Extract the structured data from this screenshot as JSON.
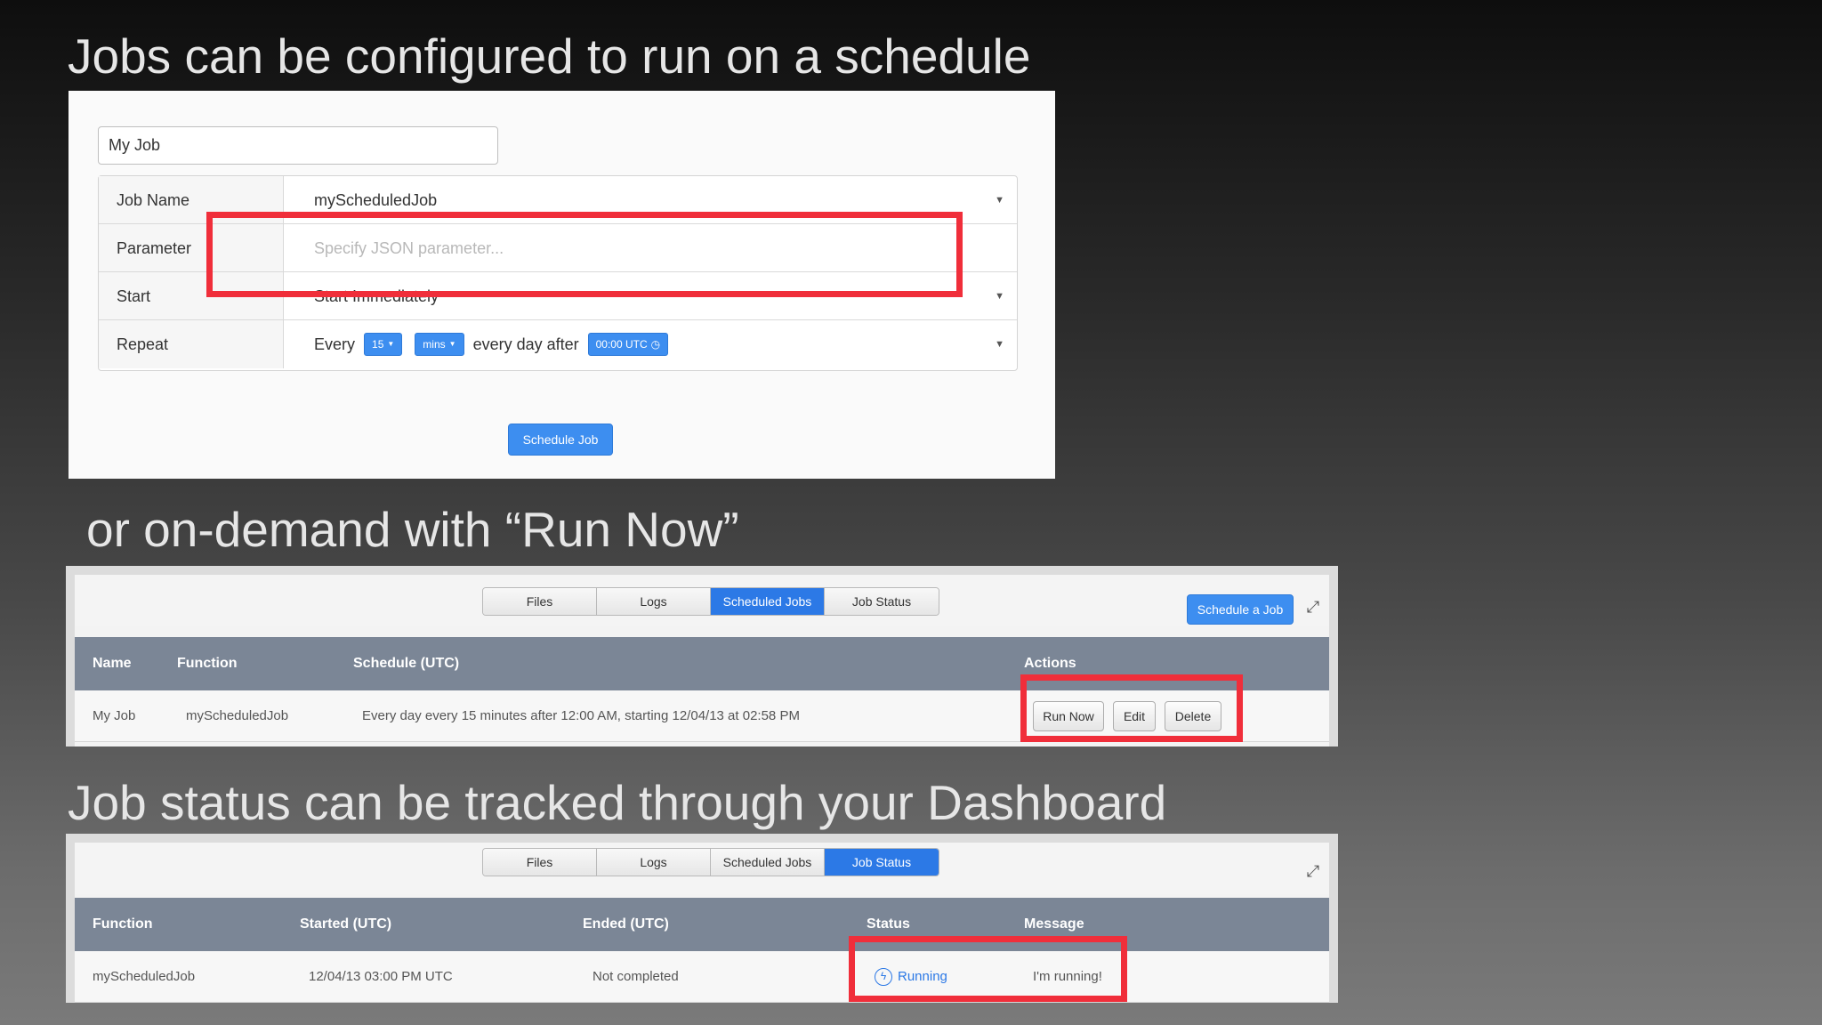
{
  "headings": {
    "schedule": "Jobs can be configured to run on a schedule",
    "on_demand": "or on-demand with “Run Now”",
    "status": "Job status can be tracked through your Dashboard"
  },
  "schedule_form": {
    "job_title_value": "My Job",
    "rows": {
      "job_name": {
        "label": "Job Name",
        "value": "myScheduledJob"
      },
      "parameter": {
        "label": "Parameter",
        "placeholder": "Specify JSON parameter..."
      },
      "start": {
        "label": "Start",
        "value": "Start Immediately"
      },
      "repeat": {
        "label": "Repeat",
        "every_text": "Every",
        "interval_value": "15",
        "unit_value": "mins",
        "after_text": "every day after",
        "time_value": "00:00 UTC"
      }
    },
    "submit_label": "Schedule Job"
  },
  "scheduled_jobs_panel": {
    "tabs": [
      "Files",
      "Logs",
      "Scheduled Jobs",
      "Job Status"
    ],
    "active_tab": "Scheduled Jobs",
    "schedule_button_label": "Schedule a Job",
    "columns": [
      "Name",
      "Function",
      "Schedule (UTC)",
      "Actions"
    ],
    "row": {
      "name": "My Job",
      "function": "myScheduledJob",
      "schedule": "Every day every 15 minutes after 12:00 AM, starting 12/04/13 at 02:58 PM",
      "actions": [
        "Run Now",
        "Edit",
        "Delete"
      ]
    }
  },
  "job_status_panel": {
    "tabs": [
      "Files",
      "Logs",
      "Scheduled Jobs",
      "Job Status"
    ],
    "active_tab": "Job Status",
    "columns": [
      "Function",
      "Started (UTC)",
      "Ended (UTC)",
      "Status",
      "Message"
    ],
    "row": {
      "function": "myScheduledJob",
      "started": "12/04/13 03:00 PM UTC",
      "ended": "Not completed",
      "status": "Running",
      "message": "I'm running!"
    }
  },
  "colors": {
    "accent": "#3d8ef0",
    "highlight": "#f02e3a",
    "table_header": "#7b8696"
  }
}
